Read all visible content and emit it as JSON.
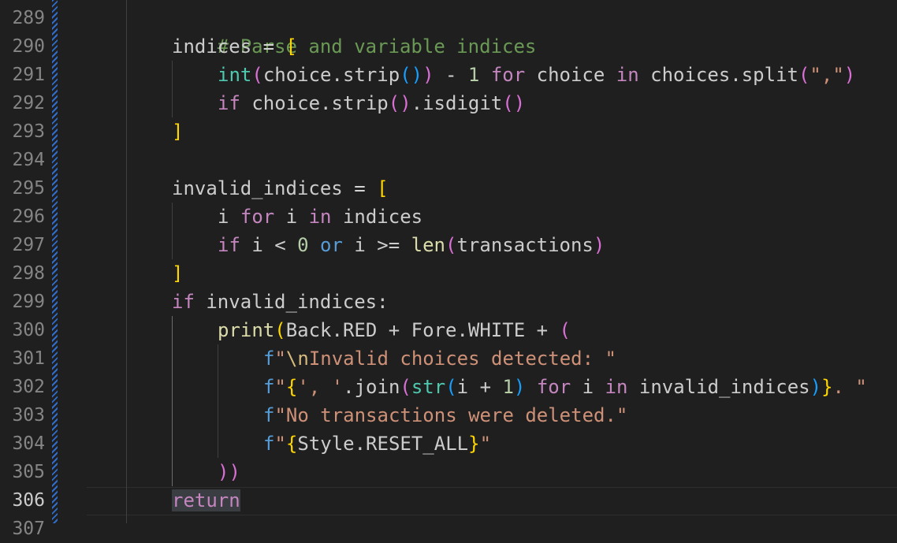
{
  "gutter": {
    "line_numbers": [
      "289",
      "290",
      "291",
      "292",
      "293",
      "294",
      "295",
      "296",
      "297",
      "298",
      "299",
      "300",
      "301",
      "302",
      "303",
      "304",
      "305",
      "306",
      "307"
    ],
    "active_line": "306"
  },
  "code": {
    "l289": {
      "comment": "# Parse and variable indices"
    },
    "l290": {
      "name": "indices",
      "eq": " = ",
      "bracket": "["
    },
    "l291": {
      "fn": "int",
      "p_open": "(",
      "text1": "choice.strip",
      "inner": "()",
      "p_close": ")",
      "op": " - ",
      "num": "1",
      "kw_for": " for ",
      "text2": "choice",
      "kw_in": " in ",
      "text3": "choices.split",
      "p2_open": "(",
      "str": "\",\"",
      "p2_close": ")"
    },
    "l292": {
      "kw_if": "if",
      "text": " choice.strip",
      "p1": "()",
      "text2": ".isdigit",
      "p2": "()"
    },
    "l293": {
      "bracket": "]"
    },
    "l295": {
      "name": "invalid_indices",
      "eq": " = ",
      "bracket": "["
    },
    "l296": {
      "text1": "i",
      "kw_for": " for ",
      "text2": "i",
      "kw_in": " in ",
      "text3": "indices"
    },
    "l297": {
      "kw_if": "if",
      "text1": " i < ",
      "num": "0",
      "kw_or": " or ",
      "text2": "i >= ",
      "fn": "len",
      "p_open": "(",
      "arg": "transactions",
      "p_close": ")"
    },
    "l298": {
      "bracket": "]"
    },
    "l299": {
      "kw_if": "if",
      "text": " invalid_indices:"
    },
    "l300": {
      "fn": "print",
      "p_open": "(",
      "text": "Back.RED + Fore.WHITE + ",
      "p2_open": "("
    },
    "l301": {
      "prefix": "f",
      "q": "\"",
      "esc": "\\n",
      "text": "Invalid choices detected: \""
    },
    "l302": {
      "prefix": "f",
      "q": "\"",
      "b_open": "{",
      "str1": "', '",
      "join": ".join",
      "p_open": "(",
      "fn": "str",
      "p2_open": "(",
      "expr": "i + ",
      "num": "1",
      "p2_close": ")",
      "kw_for": " for ",
      "v": "i",
      "kw_in": " in ",
      "iter": "invalid_indices",
      "p_close": ")",
      "b_close": "}",
      "tail": ". \""
    },
    "l303": {
      "prefix": "f",
      "text": "\"No transactions were deleted.\""
    },
    "l304": {
      "prefix": "f",
      "q": "\"",
      "b_open": "{",
      "expr": "Style.RESET_ALL",
      "b_close": "}",
      "tail": "\""
    },
    "l305": {
      "close": "))"
    },
    "l306": {
      "kw": "return"
    }
  },
  "colors": {
    "background": "#1f1f1f",
    "comment": "#6a9955",
    "keyword": "#c586c0",
    "function": "#dcdcaa",
    "string": "#ce9178",
    "number": "#b5cea8",
    "bracket_level1": "#ffd700",
    "bracket_level2": "#da70d6",
    "bracket_level3": "#179fff",
    "diff_bar": "#2f6dcc"
  }
}
